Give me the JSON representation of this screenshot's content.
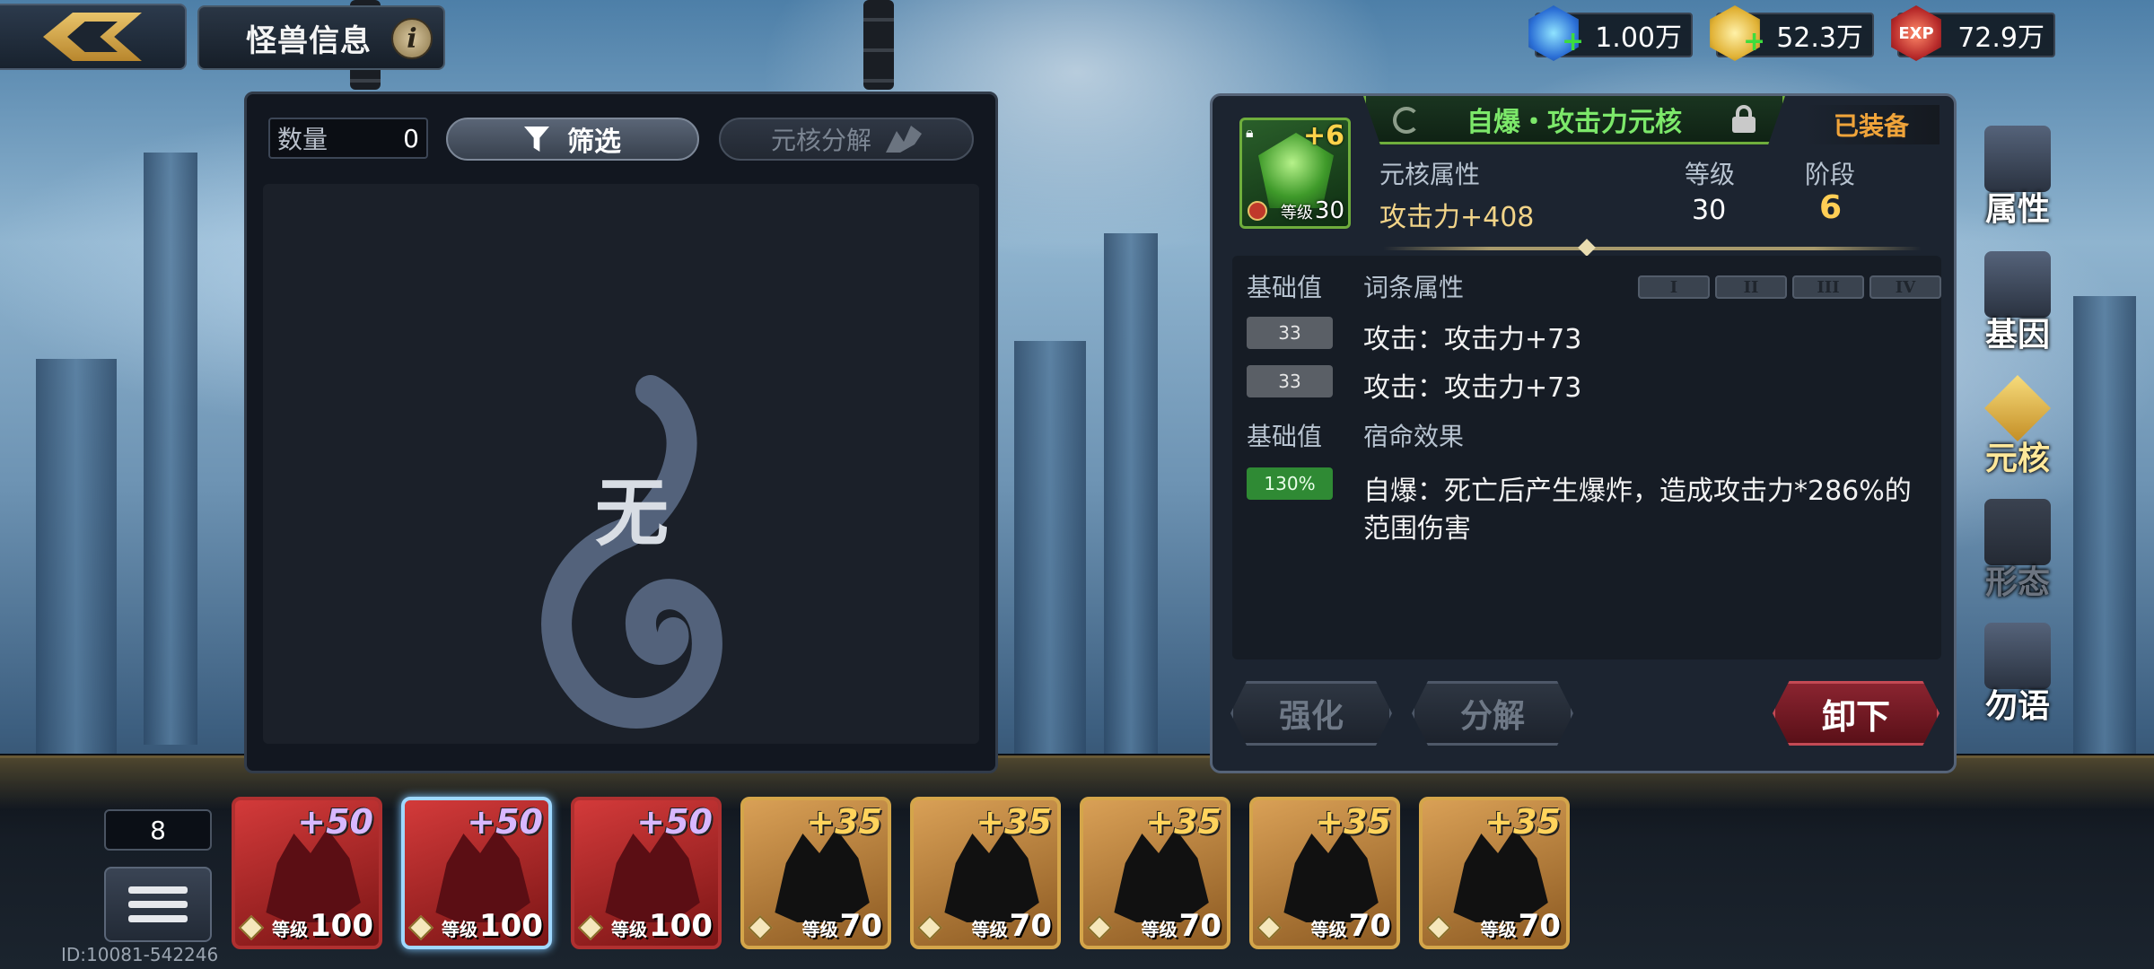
{
  "header": {
    "title": "怪兽信息",
    "info_icon": "i"
  },
  "currencies": [
    {
      "icon": "blue-crystal-icon",
      "value": "1.00万"
    },
    {
      "icon": "gold-coin-icon",
      "value": "52.3万"
    },
    {
      "icon": "exp-icon",
      "label": "EXP",
      "value": "72.9万"
    }
  ],
  "left_panel": {
    "quantity_label": "数量",
    "quantity_value": "0",
    "filter_label": "筛选",
    "decompose_label": "元核分解",
    "empty_text": "无"
  },
  "core": {
    "name": "自爆・攻击力元核",
    "plus": "+6",
    "level_label": "等级",
    "level_value": "30",
    "equipped": "已装备",
    "attr_header": "元核属性",
    "level_header": "等级",
    "stage_header": "阶段",
    "attr_value": "攻击力+408",
    "level": "30",
    "stage": "6"
  },
  "affixes": {
    "base_label": "基础值",
    "affix_label": "词条属性",
    "tiers": [
      "I",
      "II",
      "III",
      "IV"
    ],
    "rows": [
      {
        "base": "33",
        "text": "攻击：攻击力+73"
      },
      {
        "base": "33",
        "text": "攻击：攻击力+73"
      }
    ],
    "fate_base_label": "基础值",
    "fate_label": "宿命效果",
    "fate_base": "130%",
    "fate_text": "自爆：死亡后产生爆炸，造成攻击力*286%的范围伤害"
  },
  "actions": {
    "enhance": "强化",
    "decompose": "分解",
    "unequip": "卸下"
  },
  "side_tabs": [
    {
      "label": "属性",
      "state": "normal"
    },
    {
      "label": "基因",
      "state": "normal"
    },
    {
      "label": "元核",
      "state": "active"
    },
    {
      "label": "形态",
      "state": "dim"
    },
    {
      "label": "勿语",
      "state": "normal"
    }
  ],
  "roster": {
    "count": "8",
    "id_text": "ID:10081-542246",
    "level_label": "等级",
    "monsters": [
      {
        "plus": "+50",
        "level": "100",
        "color": "red"
      },
      {
        "plus": "+50",
        "level": "100",
        "color": "red",
        "selected": true
      },
      {
        "plus": "+50",
        "level": "100",
        "color": "red"
      },
      {
        "plus": "+35",
        "level": "70",
        "color": "gold"
      },
      {
        "plus": "+35",
        "level": "70",
        "color": "gold"
      },
      {
        "plus": "+35",
        "level": "70",
        "color": "gold"
      },
      {
        "plus": "+35",
        "level": "70",
        "color": "gold"
      },
      {
        "plus": "+35",
        "level": "70",
        "color": "gold"
      }
    ]
  },
  "colors": {
    "accent_green": "#7ce86a",
    "equipped_orange": "#f0a43a",
    "stage_gold": "#ffce55",
    "unequip_red": "#8a2430"
  }
}
